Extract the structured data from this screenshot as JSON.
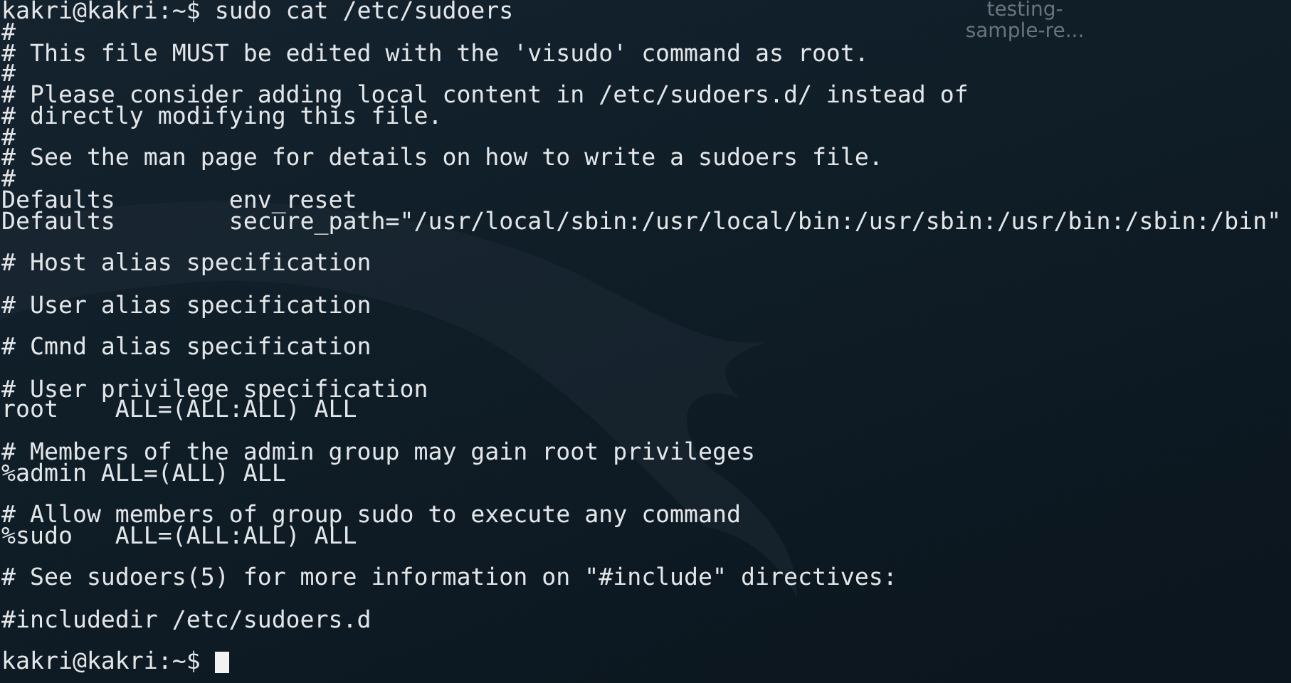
{
  "desktop_icon": {
    "label_lines": [
      "testing-",
      "sample-re..."
    ]
  },
  "terminal": {
    "lines": [
      {
        "kind": "text",
        "text": "kakri@kakri:~$ sudo cat /etc/sudoers"
      },
      {
        "kind": "text",
        "text": "#"
      },
      {
        "kind": "text",
        "text": "# This file MUST be edited with the 'visudo' command as root."
      },
      {
        "kind": "text",
        "text": "#"
      },
      {
        "kind": "text",
        "text": "# Please consider adding local content in /etc/sudoers.d/ instead of"
      },
      {
        "kind": "text",
        "text": "# directly modifying this file."
      },
      {
        "kind": "text",
        "text": "#"
      },
      {
        "kind": "text",
        "text": "# See the man page for details on how to write a sudoers file."
      },
      {
        "kind": "text",
        "text": "#"
      },
      {
        "kind": "text",
        "text": "Defaults        env_reset"
      },
      {
        "kind": "text",
        "text": "Defaults        secure_path=\"/usr/local/sbin:/usr/local/bin:/usr/sbin:/usr/bin:/sbin:/bin\""
      },
      {
        "kind": "blank"
      },
      {
        "kind": "text",
        "text": "# Host alias specification"
      },
      {
        "kind": "blank"
      },
      {
        "kind": "text",
        "text": "# User alias specification"
      },
      {
        "kind": "blank"
      },
      {
        "kind": "text",
        "text": "# Cmnd alias specification"
      },
      {
        "kind": "blank"
      },
      {
        "kind": "text",
        "text": "# User privilege specification"
      },
      {
        "kind": "text",
        "text": "root    ALL=(ALL:ALL) ALL"
      },
      {
        "kind": "blank"
      },
      {
        "kind": "text",
        "text": "# Members of the admin group may gain root privileges"
      },
      {
        "kind": "text",
        "text": "%admin ALL=(ALL) ALL"
      },
      {
        "kind": "blank"
      },
      {
        "kind": "text",
        "text": "# Allow members of group sudo to execute any command"
      },
      {
        "kind": "text",
        "text": "%sudo   ALL=(ALL:ALL) ALL"
      },
      {
        "kind": "blank"
      },
      {
        "kind": "text",
        "text": "# See sudoers(5) for more information on \"#include\" directives:"
      },
      {
        "kind": "blank"
      },
      {
        "kind": "text",
        "text": "#includedir /etc/sudoers.d"
      },
      {
        "kind": "blank"
      },
      {
        "kind": "prompt",
        "text": "kakri@kakri:~$",
        "cursor": true
      }
    ]
  }
}
